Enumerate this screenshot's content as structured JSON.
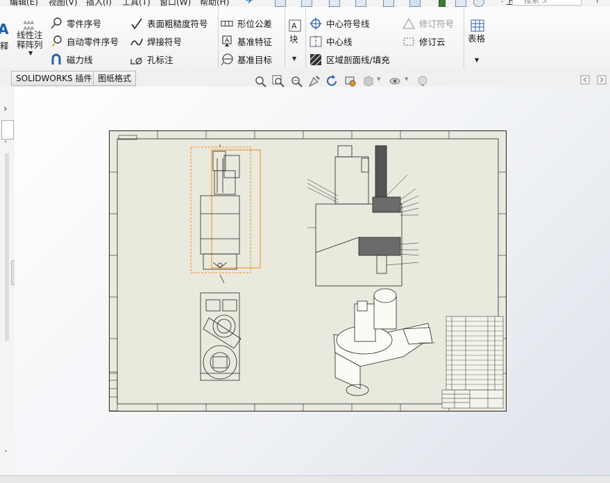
{
  "menu": {
    "items": [
      "编辑(E)",
      "视图(V)",
      "插入(I)",
      "工具(T)",
      "窗口(W)",
      "帮助(H)"
    ],
    "search_placeholder": "搜索 S"
  },
  "ribbon": {
    "partial_left": "释",
    "linear_pattern": [
      "线性注",
      "释阵列"
    ],
    "balloon": "零件序号",
    "auto_balloon": "自动零件序号",
    "magnetic_line": "磁力线",
    "surface_finish": "表面粗糙度符号",
    "weld_symbol": "焊接符号",
    "hole_callout": "孔标注",
    "geometric_tolerance": "形位公差",
    "datum_feature": "基准特征",
    "datum_target": "基准目标",
    "block": "块",
    "center_mark": "中心符号线",
    "centerline": "中心线",
    "area_hatch": "区域剖面线/填充",
    "revision_symbol": "修订符号",
    "revision_cloud": "修订云",
    "table": "表格"
  },
  "tabs": [
    "SOLIDWORKS 插件",
    "图纸格式"
  ],
  "icons": {
    "view_toolbar": [
      "zoom-to-fit-icon",
      "zoom-to-area-icon",
      "zoom-in-out-icon",
      "select-icon",
      "rotate-icon",
      "pan-icon",
      "display-style-icon",
      "hide-show-icon",
      "appearance-icon"
    ],
    "window_controls": [
      "restore-icon",
      "collapse-icon"
    ]
  },
  "colors": {
    "sheet": "#e9e9dd",
    "selection": "#f08a18",
    "canvas_top": "#ffffff",
    "canvas_bottom": "#dfe3ea"
  }
}
